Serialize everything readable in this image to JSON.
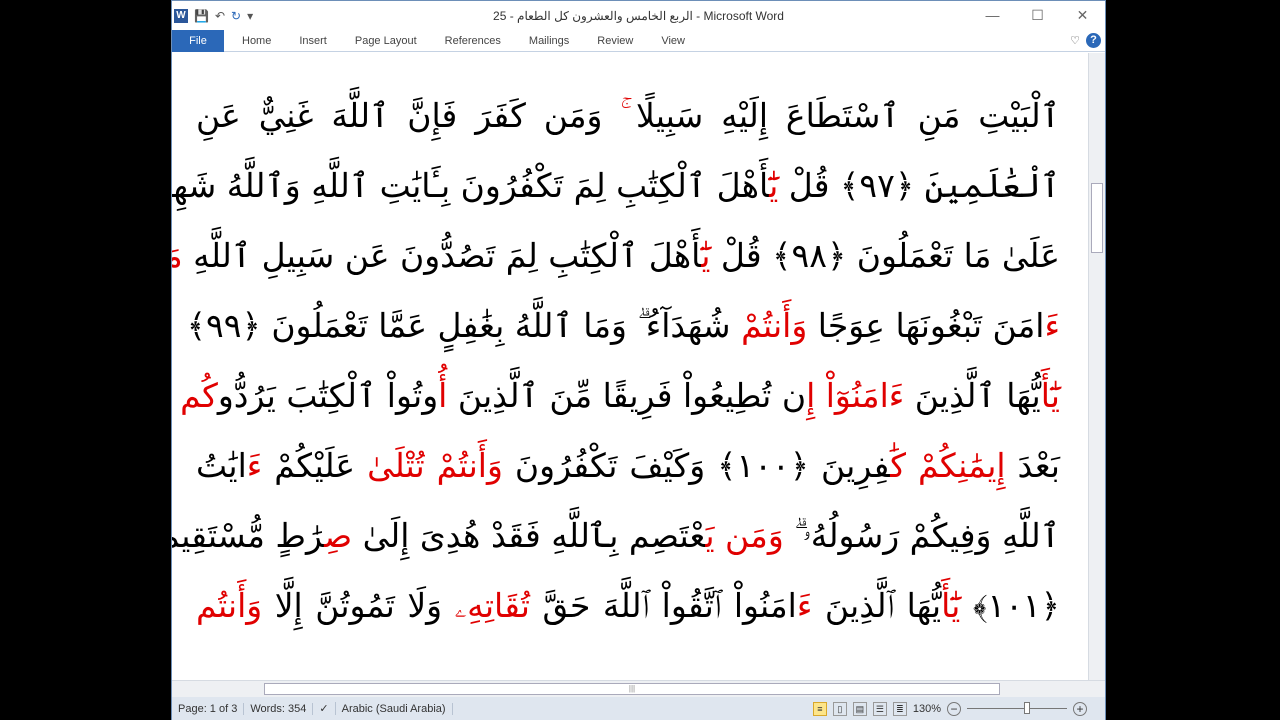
{
  "window": {
    "title": "25 - الربع الخامس والعشرون كل الطعام - Microsoft Word",
    "min": "—",
    "max": "☐",
    "close": "✕"
  },
  "ribbon": {
    "file": "File",
    "tabs": [
      "Home",
      "Insert",
      "Page Layout",
      "References",
      "Mailings",
      "Review",
      "View"
    ],
    "help": "?"
  },
  "document": {
    "lines": [
      [
        {
          "t": "ٱلْبَيْتِ مَنِ ٱسْتَطَاعَ إِلَيْهِ سَبِيلًا",
          "r": 0
        },
        {
          "t": " ۚ ",
          "r": 1
        },
        {
          "t": "وَمَن كَفَرَ فَإِنَّ ٱللَّهَ غَنِيٌّ عَنِ",
          "r": 0
        }
      ],
      [
        {
          "t": "ٱلْعَٰلَمِينَ ﴿٩٧﴾ قُلْ ",
          "r": 0
        },
        {
          "t": "يَٰٓ",
          "r": 1
        },
        {
          "t": "أَهْلَ ٱلْكِتَٰبِ لِمَ تَكْفُرُونَ بِـَٔايَٰتِ ٱللَّهِ وَٱللَّهُ شَهِيدٌ",
          "r": 0
        }
      ],
      [
        {
          "t": "عَلَىٰ مَا تَعْمَلُونَ ﴿٩٨﴾ قُلْ ",
          "r": 0
        },
        {
          "t": "يَٰٓ",
          "r": 1
        },
        {
          "t": "أَهْلَ ٱلْكِتَٰبِ لِمَ تَصُدُّونَ عَن سَبِيلِ ٱللَّهِ ",
          "r": 0
        },
        {
          "t": "مَنْ",
          "r": 1
        }
      ],
      [
        {
          "t": "ءَ",
          "r": 1
        },
        {
          "t": "امَنَ تَبْغُونَهَا عِوَجًا ",
          "r": 0
        },
        {
          "t": "وَأَنتُمْ",
          "r": 1
        },
        {
          "t": " شُهَدَآءُ ۗ وَمَا ٱللَّهُ بِغَٰفِلٍ عَمَّا تَعْمَلُونَ ﴿٩٩﴾",
          "r": 0
        }
      ],
      [
        {
          "t": "يَٰٓأَ",
          "r": 1
        },
        {
          "t": "يُّهَا ٱلَّذِينَ ",
          "r": 0
        },
        {
          "t": "ءَامَنُوٓاْ إِ",
          "r": 1
        },
        {
          "t": "ن تُطِيعُواْ فَرِيقًا مِّنَ ٱلَّذِينَ ",
          "r": 0
        },
        {
          "t": "أُ",
          "r": 1
        },
        {
          "t": "وتُواْ ٱلْكِتَٰبَ يَرُدُّو",
          "r": 0
        },
        {
          "t": "كُم",
          "r": 1
        }
      ],
      [
        {
          "t": "بَعْدَ ",
          "r": 0
        },
        {
          "t": "إِيمَٰنِكُمْ كَٰ",
          "r": 1
        },
        {
          "t": "فِرِينَ ﴿١٠٠﴾ وَكَيْفَ تَكْفُرُونَ ",
          "r": 0
        },
        {
          "t": "وَأَنتُمْ",
          "r": 1
        },
        {
          "t": " ",
          "r": 0
        },
        {
          "t": "تُتْلَىٰ",
          "r": 1
        },
        {
          "t": " عَلَيْكُمْ ",
          "r": 0
        },
        {
          "t": "ءَ",
          "r": 1
        },
        {
          "t": "ايَٰتُ",
          "r": 0
        }
      ],
      [
        {
          "t": "ٱللَّهِ وَفِيكُمْ رَسُولُهُۥ ۗ ",
          "r": 0
        },
        {
          "t": "وَمَن يَ",
          "r": 1
        },
        {
          "t": "عْتَصِم بِٱللَّهِ فَقَدْ هُدِىَ إِلَىٰ ",
          "r": 0
        },
        {
          "t": "صِ",
          "r": 1
        },
        {
          "t": "رَٰطٍ مُّسْتَقِيمٍ",
          "r": 0
        }
      ],
      [
        {
          "t": "﴿١٠١﴾ ",
          "r": 0
        },
        {
          "t": "يَٰٓأَ",
          "r": 1
        },
        {
          "t": "يُّهَا ٱلَّذِينَ ",
          "r": 0
        },
        {
          "t": "ءَ",
          "r": 1
        },
        {
          "t": "امَنُواْ ٱتَّقُواْ ٱللَّهَ حَقَّ ",
          "r": 0
        },
        {
          "t": "تُقَاتِهِۦ",
          "r": 1
        },
        {
          "t": " وَلَا تَمُوتُنَّ إِلَّا ",
          "r": 0
        },
        {
          "t": "وَأَنتُم",
          "r": 1
        }
      ]
    ]
  },
  "status": {
    "page": "Page: 1 of 3",
    "words": "Words: 354",
    "language": "Arabic (Saudi Arabia)",
    "zoom": "130%",
    "zoom_minus": "−",
    "zoom_plus": "+",
    "zoom_fraction": 0.6
  },
  "colors": {
    "accent": "#2b68b8",
    "red_text": "#e00000"
  }
}
